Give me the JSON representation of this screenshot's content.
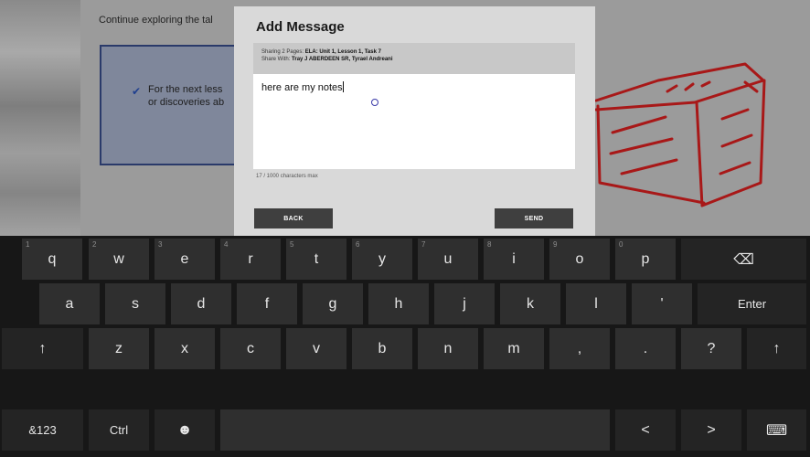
{
  "background": {
    "heading": "Continue exploring the tal",
    "list_line_1": "For the next less",
    "list_line_2": "or discoveries ab"
  },
  "dialog": {
    "title": "Add Message",
    "sharing_label": "Sharing 2 Pages:",
    "sharing_value": "ELA: Unit 1, Lesson 1, Task 7",
    "share_with_label": "Share With:",
    "share_with_value": "Tray J ABERDEEN SR, Tyrael Andreani",
    "message_text": "here are my notes",
    "char_count": "17 / 1000 characters max",
    "back_label": "BACK",
    "send_label": "SEND"
  },
  "keyboard": {
    "row1": [
      {
        "num": "1",
        "label": "q"
      },
      {
        "num": "2",
        "label": "w"
      },
      {
        "num": "3",
        "label": "e"
      },
      {
        "num": "4",
        "label": "r"
      },
      {
        "num": "5",
        "label": "t"
      },
      {
        "num": "6",
        "label": "y"
      },
      {
        "num": "7",
        "label": "u"
      },
      {
        "num": "8",
        "label": "i"
      },
      {
        "num": "9",
        "label": "o"
      },
      {
        "num": "0",
        "label": "p"
      }
    ],
    "backspace_label": "⌫",
    "row2": [
      "a",
      "s",
      "d",
      "f",
      "g",
      "h",
      "j",
      "k",
      "l",
      "'"
    ],
    "enter_label": "Enter",
    "row3": [
      "z",
      "x",
      "c",
      "v",
      "b",
      "n",
      "m",
      ",",
      ".",
      "?"
    ],
    "shift_label": "↑",
    "symbols_label": "&123",
    "ctrl_label": "Ctrl",
    "emoji_label": "☻",
    "left_label": "<",
    "right_label": ">",
    "keyboard_icon_label": "⌨"
  }
}
